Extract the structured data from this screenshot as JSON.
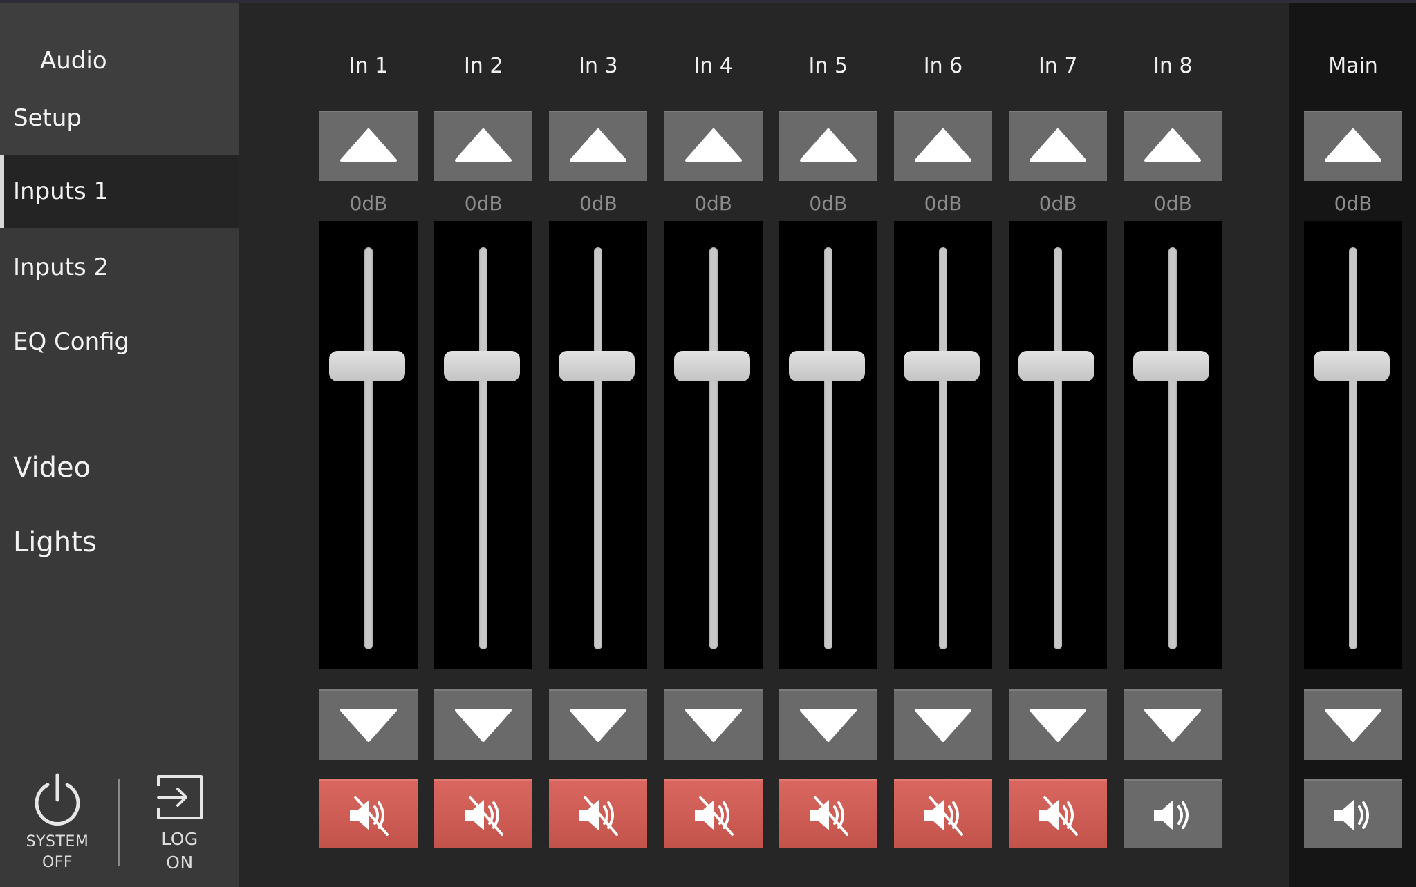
{
  "nav": {
    "audio": "Audio",
    "items": [
      {
        "label": "Setup"
      },
      {
        "label": "Inputs 1"
      },
      {
        "label": "Inputs 2"
      },
      {
        "label": "EQ Config"
      },
      {
        "label": "Video"
      },
      {
        "label": "Lights"
      }
    ],
    "active": "Inputs 1"
  },
  "system": {
    "off_line1": "SYSTEM",
    "off_line2": "OFF",
    "log_line1": "LOG",
    "log_line2": "ON"
  },
  "channels": [
    {
      "label": "In 1",
      "level": "0dB",
      "muted": true
    },
    {
      "label": "In 2",
      "level": "0dB",
      "muted": true
    },
    {
      "label": "In 3",
      "level": "0dB",
      "muted": true
    },
    {
      "label": "In 4",
      "level": "0dB",
      "muted": true
    },
    {
      "label": "In 5",
      "level": "0dB",
      "muted": true
    },
    {
      "label": "In 6",
      "level": "0dB",
      "muted": true
    },
    {
      "label": "In 7",
      "level": "0dB",
      "muted": true
    },
    {
      "label": "In 8",
      "level": "0dB",
      "muted": false
    }
  ],
  "main_channel": {
    "label": "Main",
    "level": "0dB",
    "muted": false
  },
  "fader_position_fraction": 0.75,
  "colors": {
    "muted": "#c9574f",
    "button": "#6a6a6a",
    "track": "#000000"
  },
  "icons": {
    "up": "triangle-up-icon",
    "down": "triangle-down-icon",
    "muted": "speaker-muted-icon",
    "unmuted": "speaker-icon",
    "power": "power-icon",
    "login": "login-icon"
  }
}
